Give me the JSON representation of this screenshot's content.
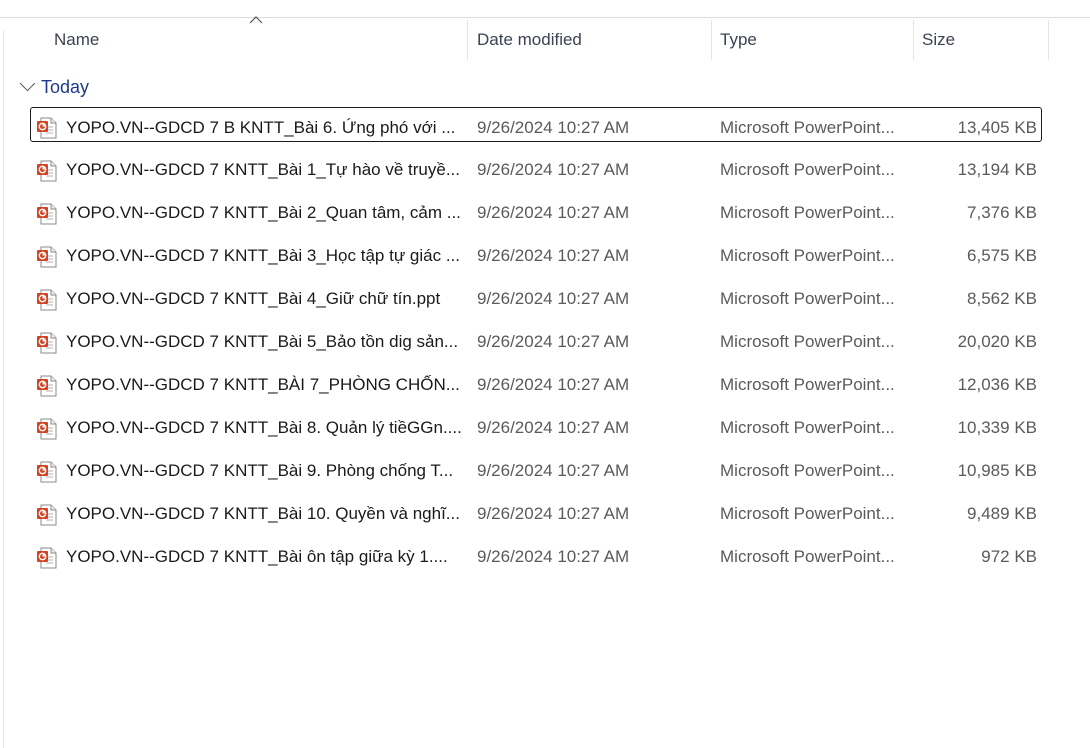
{
  "columns": {
    "name": "Name",
    "date": "Date modified",
    "type": "Type",
    "size": "Size"
  },
  "group": {
    "label": "Today"
  },
  "icon": "powerpoint-file-icon",
  "files": [
    {
      "name": "YOPO.VN--GDCD 7 B KNTT_Bài 6. Ứng phó với ...",
      "date": "9/26/2024 10:27 AM",
      "type": "Microsoft PowerPoint...",
      "size": "13,405 KB"
    },
    {
      "name": "YOPO.VN--GDCD 7 KNTT_Bài 1_Tự hào về truyề...",
      "date": "9/26/2024 10:27 AM",
      "type": "Microsoft PowerPoint...",
      "size": "13,194 KB"
    },
    {
      "name": "YOPO.VN--GDCD 7 KNTT_Bài 2_Quan tâm, cảm ...",
      "date": "9/26/2024 10:27 AM",
      "type": "Microsoft PowerPoint...",
      "size": "7,376 KB"
    },
    {
      "name": "YOPO.VN--GDCD 7 KNTT_Bài 3_Học tập tự giác ...",
      "date": "9/26/2024 10:27 AM",
      "type": "Microsoft PowerPoint...",
      "size": "6,575 KB"
    },
    {
      "name": "YOPO.VN--GDCD 7 KNTT_Bài 4_Giữ chữ tín.ppt",
      "date": "9/26/2024 10:27 AM",
      "type": "Microsoft PowerPoint...",
      "size": "8,562 KB"
    },
    {
      "name": "YOPO.VN--GDCD 7 KNTT_Bài 5_Bảo tồn dig sản...",
      "date": "9/26/2024 10:27 AM",
      "type": "Microsoft PowerPoint...",
      "size": "20,020 KB"
    },
    {
      "name": "YOPO.VN--GDCD 7 KNTT_BÀI 7_PHÒNG CHỐN...",
      "date": "9/26/2024 10:27 AM",
      "type": "Microsoft PowerPoint...",
      "size": "12,036 KB"
    },
    {
      "name": "YOPO.VN--GDCD 7 KNTT_Bài 8. Quản lý tiềGGn....",
      "date": "9/26/2024 10:27 AM",
      "type": "Microsoft PowerPoint...",
      "size": "10,339 KB"
    },
    {
      "name": "YOPO.VN--GDCD 7 KNTT_Bài 9. Phòng chống T...",
      "date": "9/26/2024 10:27 AM",
      "type": "Microsoft PowerPoint...",
      "size": "10,985 KB"
    },
    {
      "name": "YOPO.VN--GDCD 7 KNTT_Bài 10. Quyền và nghĩ...",
      "date": "9/26/2024 10:27 AM",
      "type": "Microsoft PowerPoint...",
      "size": "9,489 KB"
    },
    {
      "name": "YOPO.VN--GDCD 7 KNTT_Bài ôn tập giữa kỳ 1....",
      "date": "9/26/2024 10:27 AM",
      "type": "Microsoft PowerPoint...",
      "size": "972 KB"
    }
  ]
}
